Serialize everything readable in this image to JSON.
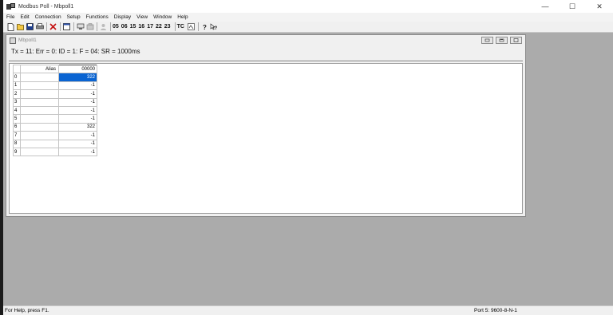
{
  "app": {
    "title": "Modbus Poll - Mbpoll1",
    "window_controls": [
      "—",
      "☐",
      "✕"
    ]
  },
  "menu": [
    "File",
    "Edit",
    "Connection",
    "Setup",
    "Functions",
    "Display",
    "View",
    "Window",
    "Help"
  ],
  "toolbar": {
    "icons": [
      "new-file-icon",
      "open-folder-icon",
      "save-icon",
      "print-icon",
      "delete-icon",
      "window-icon",
      "connect-icon",
      "disconnect-icon",
      "user-icon"
    ],
    "function_codes": [
      "05",
      "06",
      "15",
      "16",
      "17",
      "22",
      "23"
    ],
    "tc_label": "TC",
    "help_icons": [
      "help-icon",
      "context-help-icon"
    ]
  },
  "mdi": {
    "title": "Mbpoll1",
    "status": "Tx = 11: Err = 0: ID = 1: F = 04: SR = 1000ms"
  },
  "grid": {
    "alias_header": "Alias",
    "value_header": "00000",
    "rows": [
      {
        "index": "0",
        "alias": "",
        "value": "322"
      },
      {
        "index": "1",
        "alias": "",
        "value": "-1"
      },
      {
        "index": "2",
        "alias": "",
        "value": "-1"
      },
      {
        "index": "3",
        "alias": "",
        "value": "-1"
      },
      {
        "index": "4",
        "alias": "",
        "value": "-1"
      },
      {
        "index": "5",
        "alias": "",
        "value": "-1"
      },
      {
        "index": "6",
        "alias": "",
        "value": "322"
      },
      {
        "index": "7",
        "alias": "",
        "value": "-1"
      },
      {
        "index": "8",
        "alias": "",
        "value": "-1"
      },
      {
        "index": "9",
        "alias": "",
        "value": "-1"
      }
    ],
    "selected_row": 0
  },
  "statusbar": {
    "help": "For Help, press F1.",
    "port": "Port 5: 9600-8-N-1"
  },
  "colors": {
    "selection": "#0a64d2",
    "workspace": "#ababab"
  }
}
